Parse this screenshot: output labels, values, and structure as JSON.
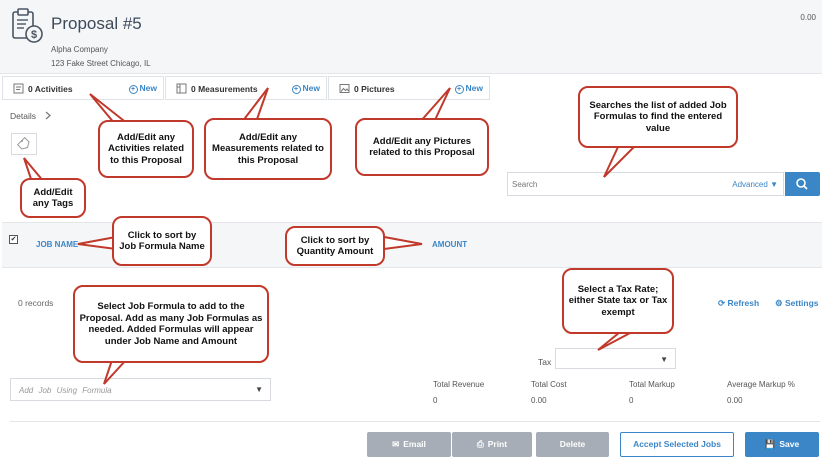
{
  "header": {
    "title": "Proposal #5",
    "company": "Alpha Company",
    "address": "123 Fake Street  Chicago, IL",
    "total": "0.00",
    "icon": "proposal-dollar-icon"
  },
  "tabs": [
    {
      "label": "0 Activities",
      "new_label": "New",
      "icon": "activity-icon"
    },
    {
      "label": "0 Measurements",
      "new_label": "New",
      "icon": "measurement-icon"
    },
    {
      "label": "0 Pictures",
      "new_label": "New",
      "icon": "picture-icon"
    }
  ],
  "details": {
    "label": "Details",
    "icon": "chevron-right-icon"
  },
  "tags": {
    "icon": "tag-icon"
  },
  "search": {
    "placeholder": "Search",
    "advanced_label": "Advanced",
    "icon": "search-icon"
  },
  "table": {
    "columns": {
      "job_name": "JOB NAME",
      "amount": "AMOUNT"
    },
    "select_all": "✔"
  },
  "records": {
    "count": "0 records",
    "refresh": "Refresh",
    "settings": "Settings"
  },
  "tax": {
    "label": "Tax",
    "selected": ""
  },
  "formula": {
    "placeholder": "Add Job Using Formula"
  },
  "summary": [
    {
      "label": "Total Revenue",
      "value": "0"
    },
    {
      "label": "Total Cost",
      "value": "0.00"
    },
    {
      "label": "Total Markup",
      "value": "0"
    },
    {
      "label": "Average Markup %",
      "value": "0.00"
    }
  ],
  "buttons": {
    "email": "Email",
    "print": "Print",
    "delete": "Delete",
    "accept": "Accept Selected Jobs",
    "save": "Save"
  },
  "callouts": {
    "activities": "Add/Edit any Activities related to this Proposal",
    "measurements": "Add/Edit any Measurements related to this Proposal",
    "pictures": "Add/Edit any Pictures related to this Proposal",
    "search": "Searches the list of added Job Formulas to find the entered value",
    "tags": "Add/Edit any Tags",
    "sort_name": "Click to sort by Job Formula Name",
    "sort_amount": "Click to sort by Quantity Amount",
    "tax": "Select a Tax Rate; either State tax or Tax exempt",
    "formula": "Select Job Formula to add to the Proposal. Add as many Job Formulas as needed. Added Formulas will appear under Job Name and Amount"
  },
  "colors": {
    "accent": "#3b86c6",
    "callout_border": "#c0392b",
    "disabled_button": "#a6adb6"
  }
}
